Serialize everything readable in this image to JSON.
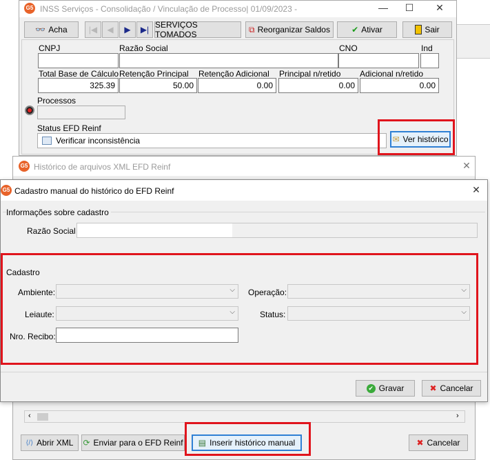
{
  "main_window": {
    "logo": "G5",
    "title": "INSS Serviços - Consolidação / Vinculação de Processo|  01/09/2023 -",
    "toolbar": {
      "acha": "Acha",
      "servicos": "SERVIÇOS TOMADOS",
      "reorganizar": "Reorganizar Saldos",
      "ativar": "Ativar",
      "sair": "Sair"
    },
    "labels": {
      "cnpj": "CNPJ",
      "razao": "Razão Social",
      "cno": "CNO",
      "ind": "Ind",
      "total_base": "Total Base de Cálculo",
      "ret_principal": "Retenção Principal",
      "ret_adicional": "Retenção Adicional",
      "principal_nretido": "Principal n/retido",
      "adicional_nretido": "Adicional n/retido",
      "processos": "Processos",
      "status_efd": "Status EFD Reinf"
    },
    "values": {
      "total_base": "325.39",
      "ret_principal": "50.00",
      "ret_adicional": "0.00",
      "principal_nretido": "0.00",
      "adicional_nretido": "0.00"
    },
    "status_text": "Verificar inconsistência",
    "ver_historico": "Ver histórico"
  },
  "historico_window": {
    "logo": "G5",
    "title": "Histórico de arquivos XML EFD Reinf",
    "abrir_xml": "Abrir XML",
    "enviar": "Enviar para o EFD Reinf",
    "inserir": "Inserir histórico manual",
    "cancelar": "Cancelar"
  },
  "cadastro_dialog": {
    "logo": "G5",
    "title": "Cadastro manual do histórico do EFD Reinf",
    "info_group": "Informações sobre cadastro",
    "razao_label": "Razão Social",
    "cadastro_group": "Cadastro",
    "ambiente_label": "Ambiente:",
    "operacao_label": "Operação:",
    "leiaute_label": "Leiaute:",
    "status_label": "Status:",
    "recibo_label": "Nro. Recibo:",
    "gravar": "Gravar",
    "cancelar": "Cancelar"
  },
  "colors": {
    "highlight": "#e0141c",
    "logo": "#e8632a"
  }
}
